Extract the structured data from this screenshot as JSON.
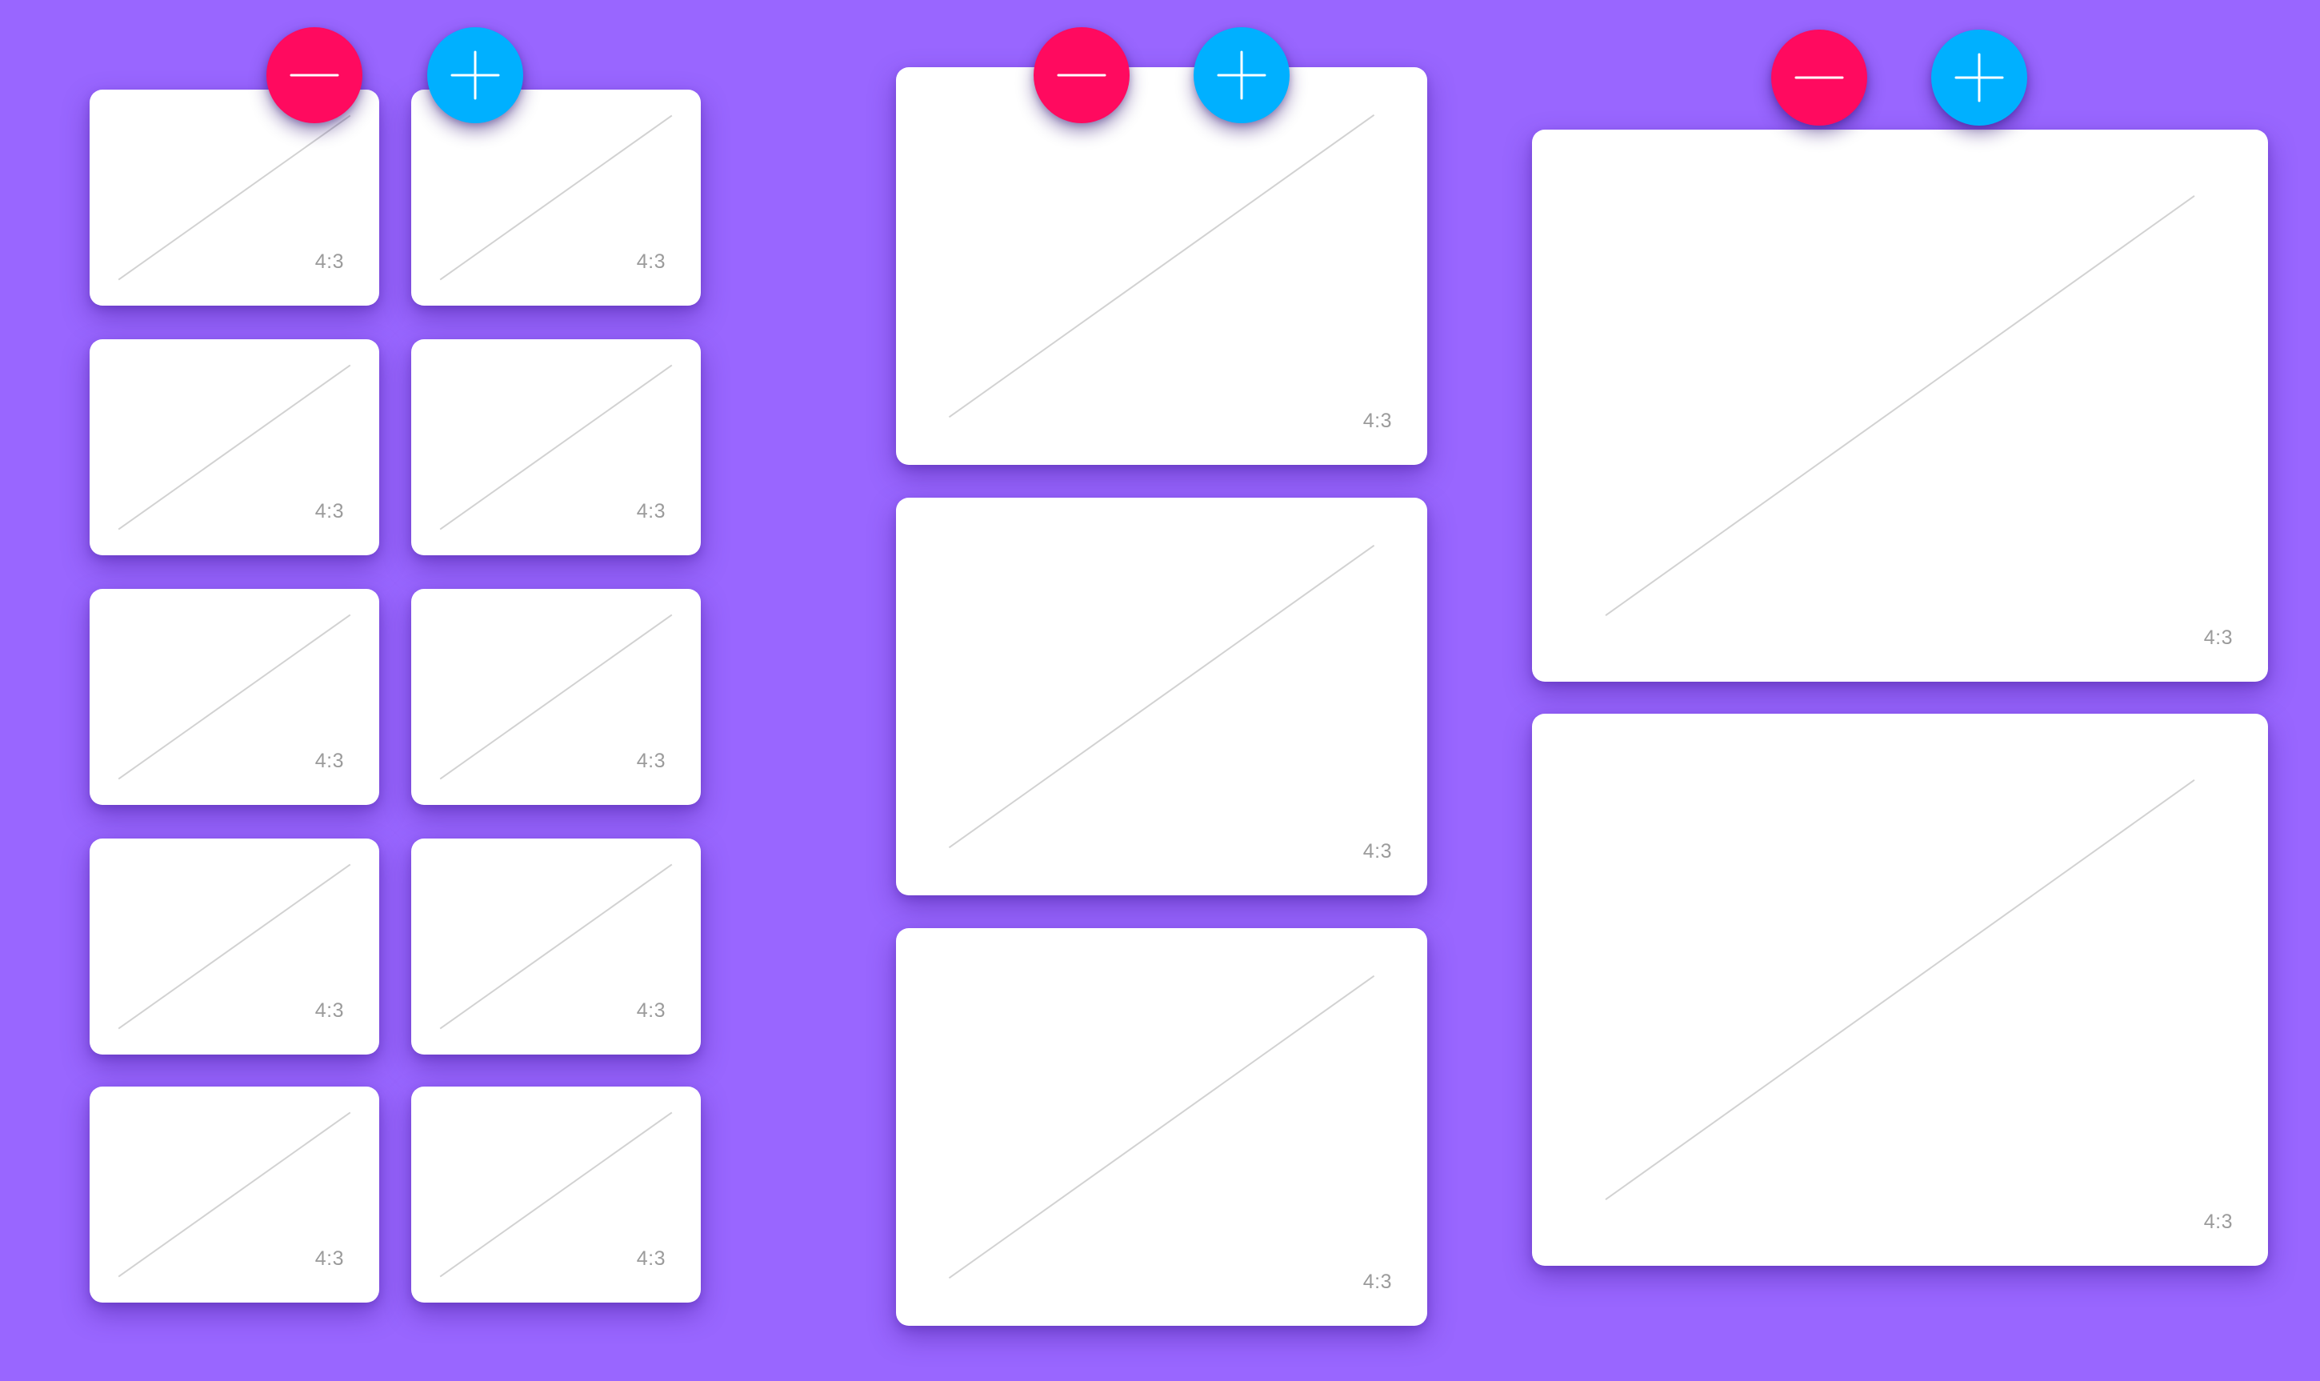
{
  "colors": {
    "background": "#9966ff",
    "decrease_button": "#ff0a5f",
    "increase_button": "#00b0ff",
    "card": "#ffffff",
    "diagonal": "#d2d2d2",
    "label": "#9b9b9b"
  },
  "icons": {
    "decrease": "minus-icon",
    "increase": "plus-icon"
  },
  "groups": [
    {
      "id": "small",
      "cards": [
        "4:3",
        "4:3",
        "4:3",
        "4:3",
        "4:3",
        "4:3",
        "4:3",
        "4:3",
        "4:3",
        "4:3"
      ]
    },
    {
      "id": "medium",
      "cards": [
        "4:3",
        "4:3",
        "4:3"
      ]
    },
    {
      "id": "large",
      "cards": [
        "4:3",
        "4:3"
      ]
    }
  ]
}
